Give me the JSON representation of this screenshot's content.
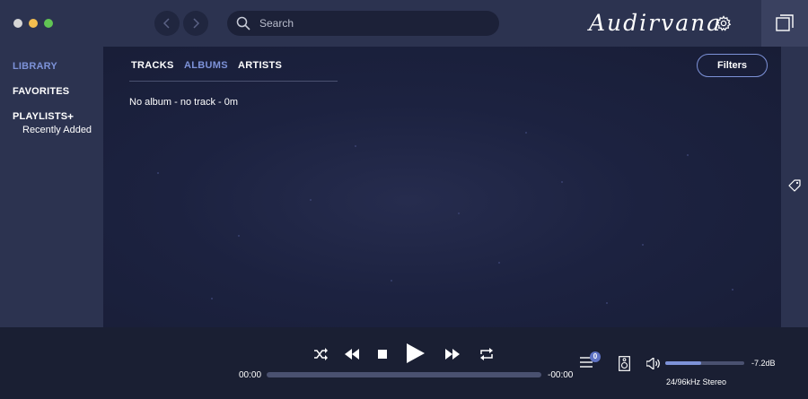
{
  "titlebar": {
    "search_placeholder": "Search",
    "brand": "Audirvana"
  },
  "icons": {
    "nav_back": "chevron-left-icon",
    "nav_forward": "chevron-right-icon",
    "search": "search-icon",
    "settings": "gear-icon",
    "miniplayer": "miniplayer-icon",
    "tag": "tag-icon"
  },
  "sidebar": {
    "library": "LIBRARY",
    "favorites": "FAVORITES",
    "playlists": "PLAYLISTS",
    "add_playlist": "+",
    "playlist_items": [
      "Recently Added"
    ]
  },
  "main": {
    "tabs": [
      {
        "label": "TRACKS",
        "active": false
      },
      {
        "label": "ALBUMS",
        "active": true
      },
      {
        "label": "ARTISTS",
        "active": false
      }
    ],
    "filters_label": "Filters",
    "empty_message": "No album - no track - 0m"
  },
  "player": {
    "elapsed": "00:00",
    "remaining": "-00:00",
    "progress": 0,
    "queue_count": "0",
    "volume_level": 0.45,
    "volume_db": "-7.2dB",
    "format": "24/96kHz Stereo"
  },
  "colors": {
    "accent": "#7d92d8",
    "panel": "#2c3350",
    "background": "#1b2138",
    "player_bar": "#1a1f33"
  }
}
